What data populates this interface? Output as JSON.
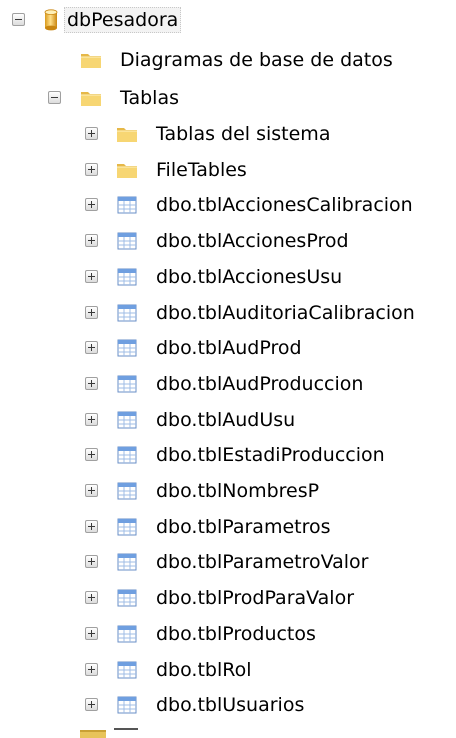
{
  "tree": {
    "database": {
      "label": "dbPesadora",
      "icon": "database-icon"
    },
    "diagrams": {
      "label": "Diagramas de base de datos",
      "icon": "folder-icon"
    },
    "tables": {
      "label": "Tablas",
      "icon": "folder-icon",
      "children": [
        {
          "label": "Tablas del sistema",
          "icon": "folder-icon"
        },
        {
          "label": "FileTables",
          "icon": "folder-icon"
        },
        {
          "label": "dbo.tblAccionesCalibracion",
          "icon": "table-icon"
        },
        {
          "label": "dbo.tblAccionesProd",
          "icon": "table-icon"
        },
        {
          "label": "dbo.tblAccionesUsu",
          "icon": "table-icon"
        },
        {
          "label": "dbo.tblAuditoriaCalibracion",
          "icon": "table-icon"
        },
        {
          "label": "dbo.tblAudProd",
          "icon": "table-icon"
        },
        {
          "label": "dbo.tblAudProduccion",
          "icon": "table-icon"
        },
        {
          "label": "dbo.tblAudUsu",
          "icon": "table-icon"
        },
        {
          "label": "dbo.tblEstadiProduccion",
          "icon": "table-icon"
        },
        {
          "label": "dbo.tblNombresP",
          "icon": "table-icon"
        },
        {
          "label": "dbo.tblParametros",
          "icon": "table-icon"
        },
        {
          "label": "dbo.tblParametroValor",
          "icon": "table-icon"
        },
        {
          "label": "dbo.tblProdParaValor",
          "icon": "table-icon"
        },
        {
          "label": "dbo.tblProductos",
          "icon": "table-icon"
        },
        {
          "label": "dbo.tblRol",
          "icon": "table-icon"
        },
        {
          "label": "dbo.tblUsuarios",
          "icon": "table-icon"
        }
      ]
    }
  }
}
